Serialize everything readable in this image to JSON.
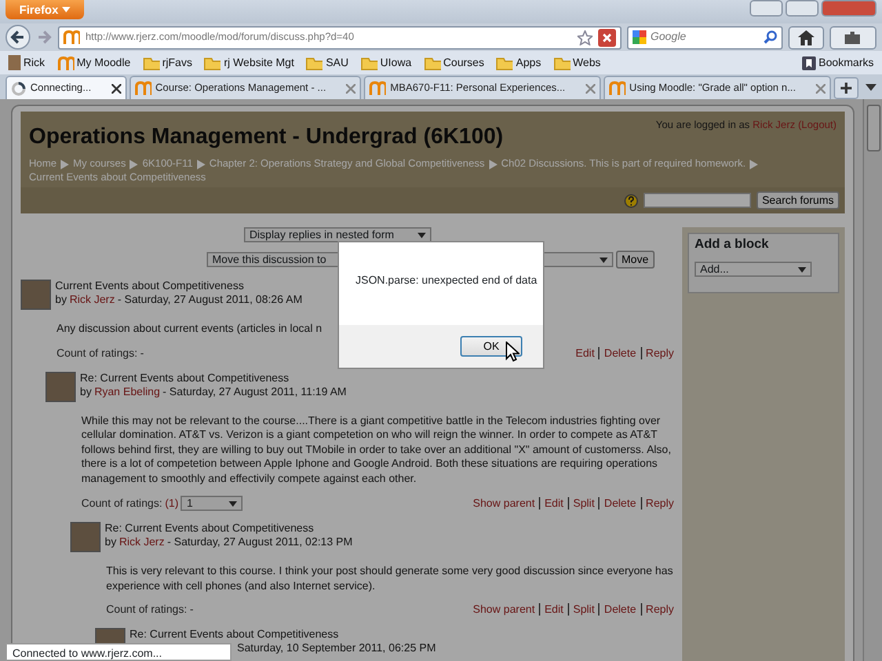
{
  "browser": {
    "menu_button": "Firefox",
    "url": "http://www.rjerz.com/moodle/mod/forum/discuss.php?d=40",
    "search_placeholder": "Google",
    "bookmarks": [
      {
        "label": "Rick",
        "kind": "person"
      },
      {
        "label": "My Moodle",
        "kind": "moodle"
      },
      {
        "label": "rjFavs",
        "kind": "folder"
      },
      {
        "label": "rj Website Mgt",
        "kind": "folder"
      },
      {
        "label": "SAU",
        "kind": "folder"
      },
      {
        "label": "UIowa",
        "kind": "folder"
      },
      {
        "label": "Courses",
        "kind": "folder"
      },
      {
        "label": "Apps",
        "kind": "folder"
      },
      {
        "label": "Webs",
        "kind": "folder"
      }
    ],
    "bookmarks_menu": "Bookmarks",
    "tabs": [
      {
        "title": "Connecting...",
        "selected": true,
        "loading": true
      },
      {
        "title": "Course: Operations Management - ...",
        "selected": false,
        "loading": false
      },
      {
        "title": "MBA670-F11: Personal Experiences...",
        "selected": false,
        "loading": false
      },
      {
        "title": "Using Moodle: \"Grade all\" option n...",
        "selected": false,
        "loading": false
      }
    ]
  },
  "page": {
    "title": "Operations Management - Undergrad (6K100)",
    "login": {
      "prefix": "You are logged in as",
      "user": "Rick Jerz",
      "logout": "(Logout)"
    },
    "breadcrumb": [
      "Home",
      "My courses",
      "6K100-F11",
      "Chapter 2: Operations Strategy and Global Competitiveness",
      "Ch02 Discussions. This is part of required homework.",
      "Current Events about Competitiveness"
    ],
    "search_button": "Search forums",
    "display_mode": "Display replies in nested form",
    "move_select": "Move this discussion to",
    "move_button": "Move",
    "block": {
      "title": "Add a block",
      "select": "Add..."
    },
    "posts": [
      {
        "subject": "Current Events about Competitiveness",
        "by": "by",
        "author": "Rick Jerz",
        "date": "- Saturday, 27 August 2011, 08:26 AM",
        "body": "Any discussion about current events (articles in local n",
        "ratings_label": "Count of ratings:",
        "ratings_count": "-",
        "count_linked": false,
        "actions": [
          "Edit",
          "Delete",
          "Reply"
        ],
        "children": [
          {
            "subject": "Re: Current Events about Competitiveness",
            "by": "by",
            "author": "Ryan Ebeling",
            "date": "- Saturday, 27 August 2011, 11:19 AM",
            "body": "While this may not be relevant to the course....There is a giant competitive battle in the Telecom industries fighting over cellular domination.  AT&T vs. Verizon is a giant competetion on who will reign the winner.  In order to compete as AT&T follows behind first, they are willing to buy out TMobile in order to take over an additional \"X\" amount of customerss.   Also, there is a lot of competetion between Apple Iphone and Google Android. Both these situations are requiring operations management to smoothly and effectivily compete against each other.",
            "ratings_label": "Count of ratings:",
            "ratings_count": "(1)",
            "count_linked": true,
            "rating_choice": "1",
            "actions": [
              "Show parent",
              "Edit",
              "Split",
              "Delete",
              "Reply"
            ],
            "children": [
              {
                "subject": "Re: Current Events about Competitiveness",
                "by": "by",
                "author": "Rick Jerz",
                "date": "- Saturday, 27 August 2011, 02:13 PM",
                "body": "This is very relevant to this course.  I think your post should generate some very good discussion since everyone has experience with cell phones (and also Internet service).",
                "ratings_label": "Count of ratings:",
                "ratings_count": "-",
                "count_linked": false,
                "actions": [
                  "Show parent",
                  "Edit",
                  "Split",
                  "Delete",
                  "Reply"
                ],
                "children": [
                  {
                    "subject": "Re: Current Events about Competitiveness",
                    "date": "Saturday, 10 September 2011, 06:25 PM"
                  }
                ]
              }
            ]
          }
        ]
      }
    ]
  },
  "dialog": {
    "message": "JSON.parse: unexpected end of data",
    "button": "OK"
  },
  "status": "Connected to www.rjerz.com..."
}
